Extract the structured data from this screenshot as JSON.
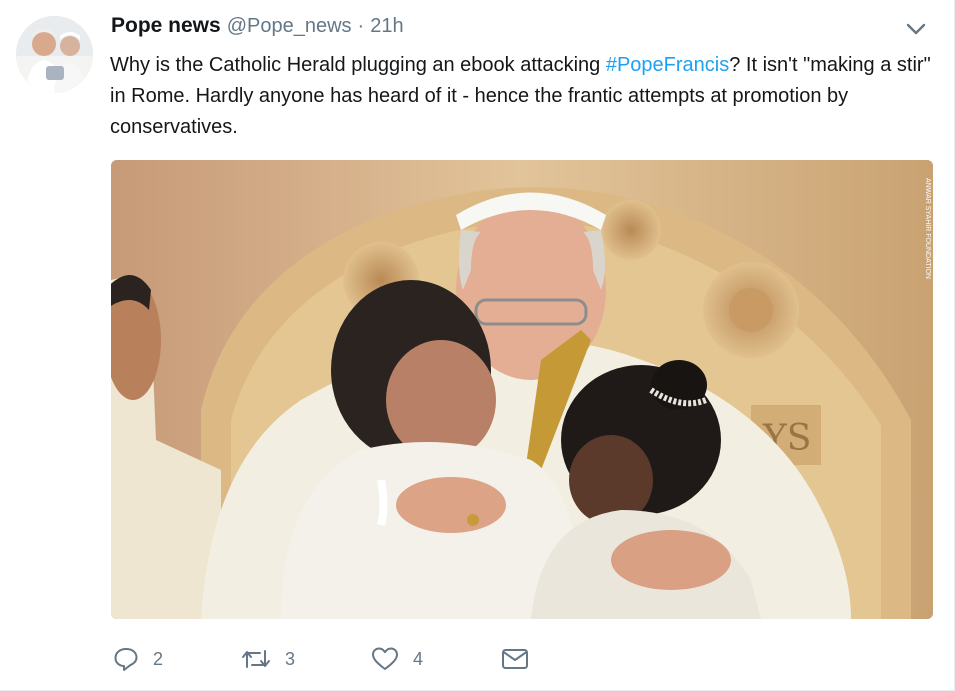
{
  "tweet": {
    "display_name": "Pope news",
    "handle": "@Pope_news",
    "separator": "·",
    "time": "21h",
    "text_part1": "Why is the Catholic Herald plugging an ebook attacking ",
    "hashtag": "#PopeFrancis",
    "text_part2": "? It isn't \"making a stir\" in Rome. Hardly anyone has heard of it - hence the frantic attempts at promotion by conservatives.",
    "photo_credit": "ANWAR SYAHIR FOUNDATION"
  },
  "actions": {
    "reply_count": "2",
    "retweet_count": "3",
    "like_count": "4"
  },
  "icons": {
    "more": "chevron-down-icon",
    "reply": "reply-icon",
    "retweet": "retweet-icon",
    "like": "heart-icon",
    "dm": "envelope-icon"
  },
  "colors": {
    "link": "#1da1f2",
    "muted": "#657786",
    "text": "#14171a"
  }
}
